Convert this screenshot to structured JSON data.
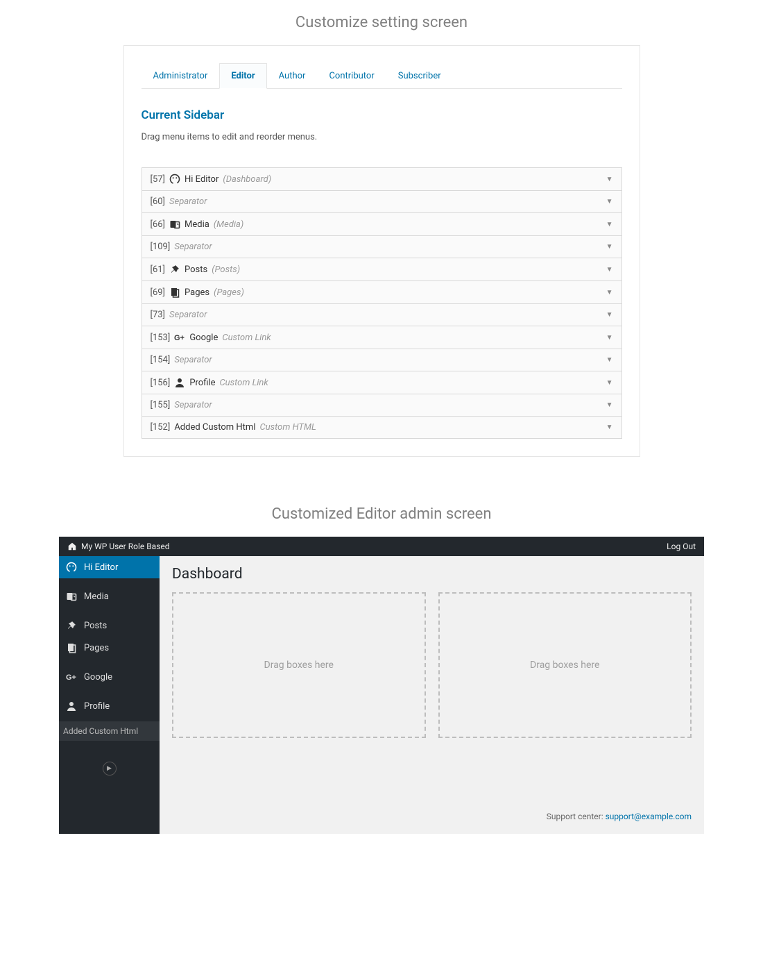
{
  "section1": {
    "title": "Customize setting screen",
    "tabs": [
      "Administrator",
      "Editor",
      "Author",
      "Contributor",
      "Subscriber"
    ],
    "active_tab_index": 1,
    "sidebar_heading": "Current Sidebar",
    "sidebar_help": "Drag menu items to edit and reorder menus.",
    "items": [
      {
        "id": "[57]",
        "icon": "smile-icon",
        "label": "Hi Editor",
        "meta": "(Dashboard)"
      },
      {
        "id": "[60]",
        "icon": null,
        "label": null,
        "meta": "Separator"
      },
      {
        "id": "[66]",
        "icon": "media-icon",
        "label": "Media",
        "meta": "(Media)"
      },
      {
        "id": "[109]",
        "icon": null,
        "label": null,
        "meta": "Separator"
      },
      {
        "id": "[61]",
        "icon": "pin-icon",
        "label": "Posts",
        "meta": "(Posts)"
      },
      {
        "id": "[69]",
        "icon": "pages-icon",
        "label": "Pages",
        "meta": "(Pages)"
      },
      {
        "id": "[73]",
        "icon": null,
        "label": null,
        "meta": "Separator"
      },
      {
        "id": "[153]",
        "icon": "gplus-icon",
        "label": "Google",
        "meta": "Custom Link"
      },
      {
        "id": "[154]",
        "icon": null,
        "label": null,
        "meta": "Separator"
      },
      {
        "id": "[156]",
        "icon": "user-icon",
        "label": "Profile",
        "meta": "Custom Link"
      },
      {
        "id": "[155]",
        "icon": null,
        "label": null,
        "meta": "Separator"
      },
      {
        "id": "[152]",
        "icon": null,
        "label": "Added Custom Html",
        "meta": "Custom HTML"
      }
    ]
  },
  "section2": {
    "title": "Customized Editor admin screen",
    "topbar_site": "My WP User Role Based",
    "topbar_logout": "Log Out",
    "sidebar": [
      {
        "icon": "smile-icon",
        "label": "Hi Editor",
        "active": true
      },
      {
        "sep": true
      },
      {
        "icon": "media-icon",
        "label": "Media"
      },
      {
        "sep": true
      },
      {
        "icon": "pin-icon",
        "label": "Posts"
      },
      {
        "icon": "pages-icon",
        "label": "Pages"
      },
      {
        "sep": true
      },
      {
        "icon": "gplus-icon",
        "label": "Google"
      },
      {
        "sep": true
      },
      {
        "icon": "user-icon",
        "label": "Profile"
      },
      {
        "muted": true,
        "label": "Added Custom Html"
      }
    ],
    "page_title": "Dashboard",
    "dropbox_text": "Drag boxes here",
    "support_prefix": "Support center: ",
    "support_email": "support@example.com"
  },
  "colors": {
    "accent": "#0073aa",
    "admin_dark": "#23282d"
  }
}
